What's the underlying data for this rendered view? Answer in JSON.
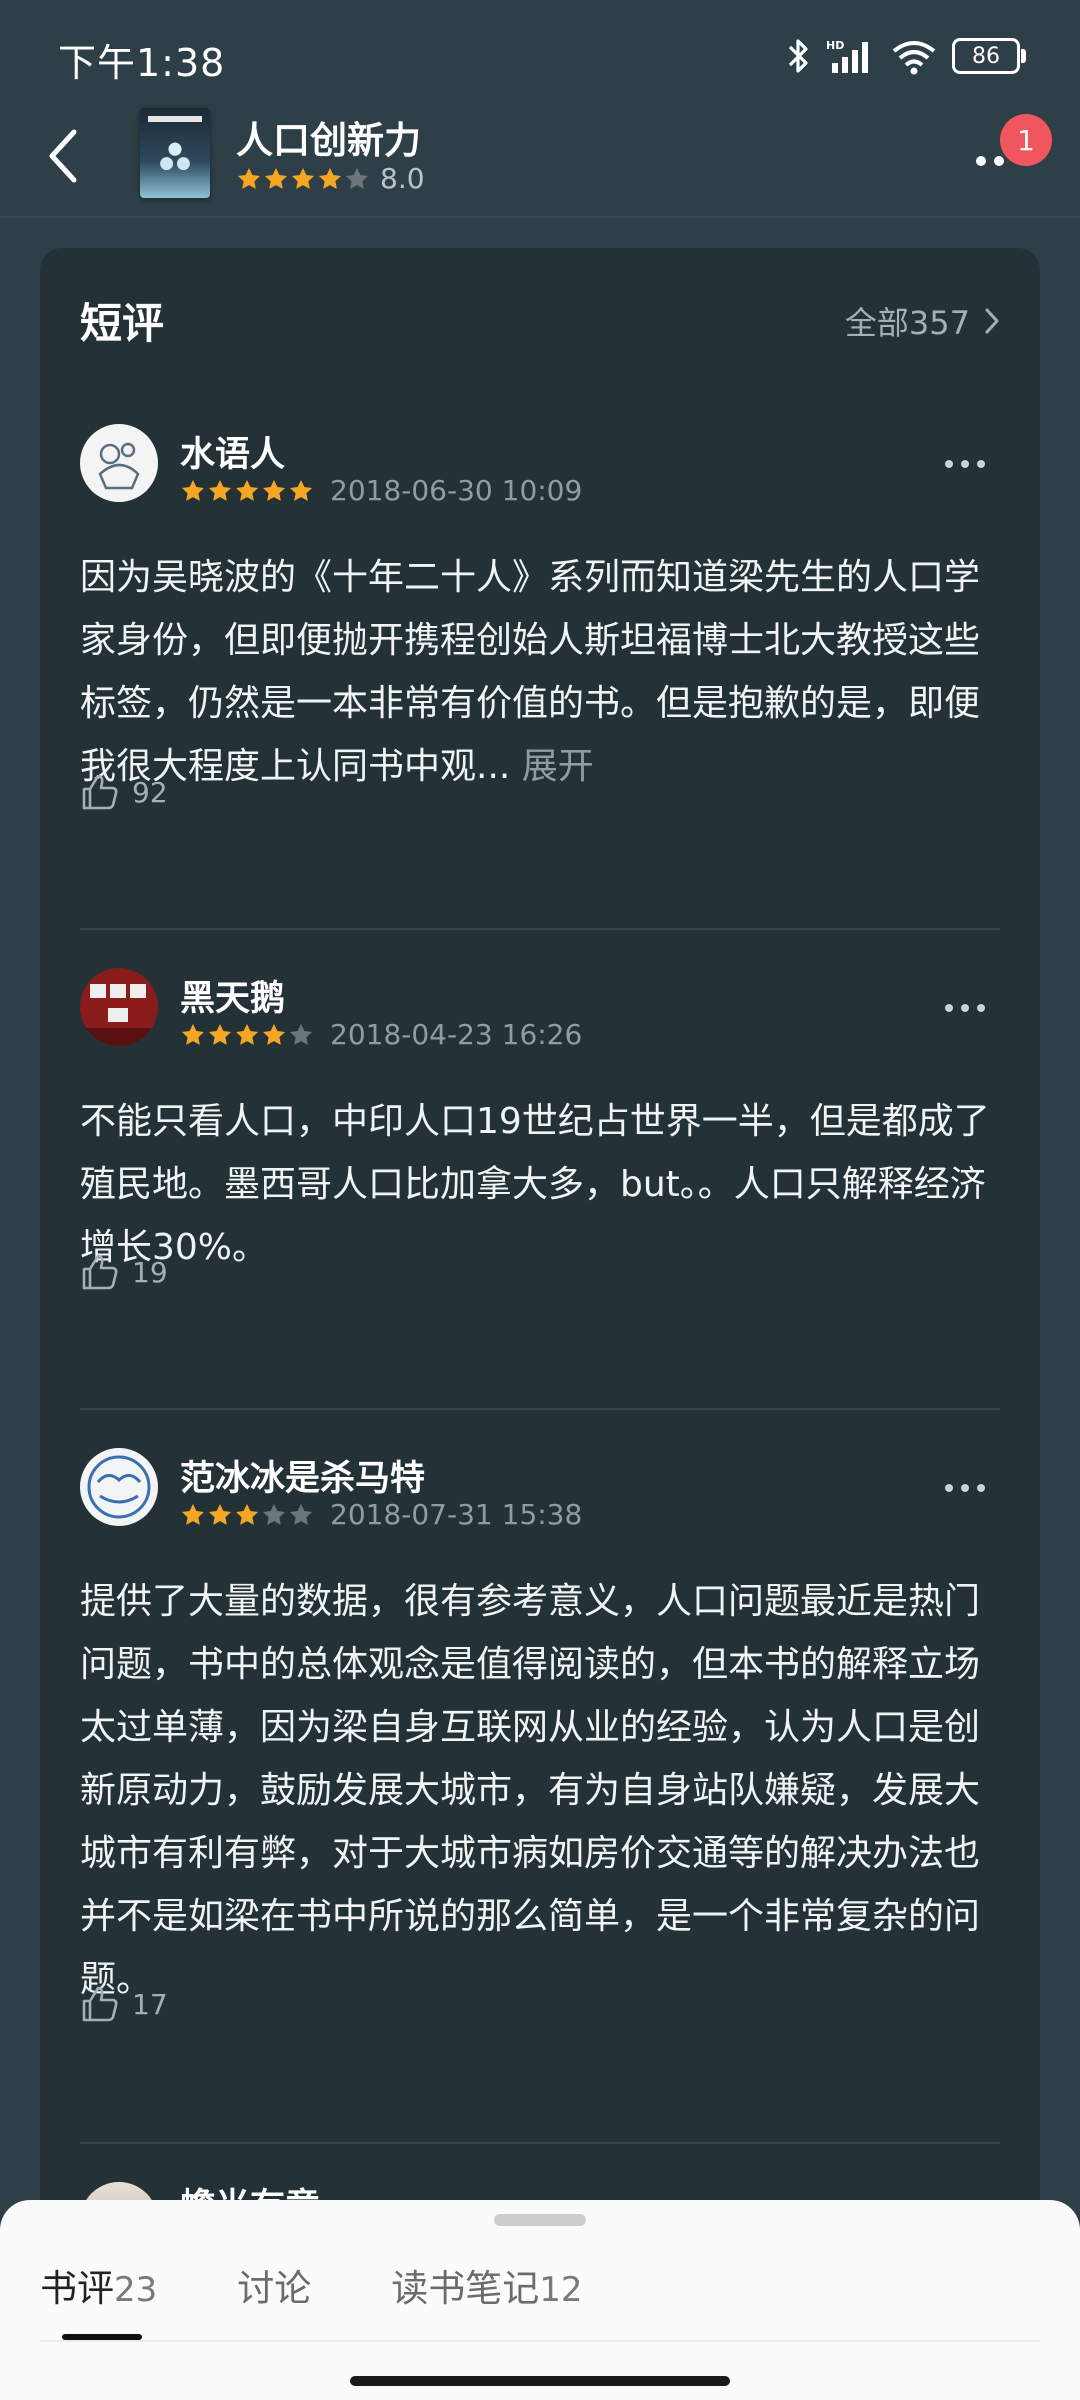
{
  "status_bar": {
    "time": "下午1:38",
    "battery": "86"
  },
  "header": {
    "book_title": "人口创新力",
    "rating_value": 4,
    "rating_score": "8.0",
    "notification_count": "1"
  },
  "section": {
    "title": "短评",
    "all_label": "全部357"
  },
  "reviews": [
    {
      "user": "水语人",
      "stars": 5,
      "date": "2018-06-30 10:09",
      "text": "因为吴晓波的《十年二十人》系列而知道梁先生的人口学家身份，但即便抛开携程创始人斯坦福博士北大教授这些标签，仍然是一本非常有价值的书。但是抱歉的是，即便我很大程度上认同书中观...",
      "expand": "展开",
      "likes": "92"
    },
    {
      "user": "黑天鹅",
      "stars": 4,
      "date": "2018-04-23 16:26",
      "text": "不能只看人口，中印人口19世纪占世界一半，但是都成了殖民地。墨西哥人口比加拿大多，but。。人口只解释经济增长30%。",
      "likes": "19"
    },
    {
      "user": "范冰冰是杀马特",
      "stars": 3,
      "date": "2018-07-31 15:38",
      "text": "提供了大量的数据，很有参考意义，人口问题最近是热门问题，书中的总体观念是值得阅读的，但本书的解释立场太过单薄，因为梁自身互联网从业的经验，认为人口是创新原动力，鼓励发展大城市，有为自身站队嫌疑，发展大城市有利有弊，对于大城市病如房价交通等的解决办法也并不是如梁在书中所说的那么简单，是一个非常复杂的问题。",
      "likes": "17"
    },
    {
      "user": "蟾光有意"
    }
  ],
  "bottom_tabs": [
    {
      "label": "书评",
      "count": "23"
    },
    {
      "label": "讨论",
      "count": ""
    },
    {
      "label": "读书笔记",
      "count": "12"
    }
  ],
  "colors": {
    "star_on": "#f5a623",
    "star_off": "#6b767a",
    "badge": "#f0565b"
  }
}
